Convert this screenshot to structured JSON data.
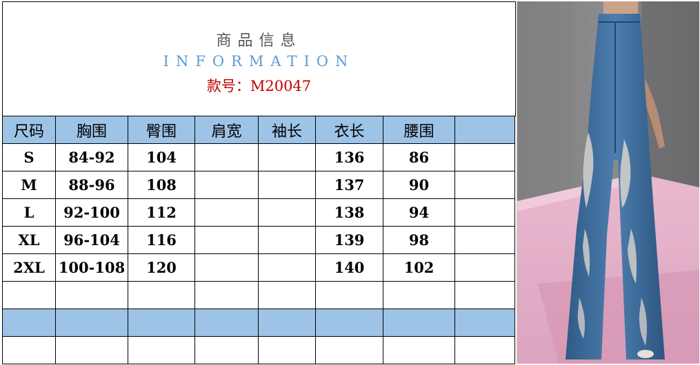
{
  "header": {
    "title_zh": "商品信息",
    "title_en": "INFORMATION",
    "model": "款号：M20047"
  },
  "table": {
    "columns": [
      "尺码",
      "胸围",
      "臀围",
      "肩宽",
      "袖长",
      "衣长",
      "腰围",
      ""
    ],
    "rows": [
      [
        "S",
        "84-92",
        "104",
        "",
        "",
        "136",
        "86",
        ""
      ],
      [
        "M",
        "88-96",
        "108",
        "",
        "",
        "137",
        "90",
        ""
      ],
      [
        "L",
        "92-100",
        "112",
        "",
        "",
        "138",
        "94",
        ""
      ],
      [
        "XL",
        "96-104",
        "116",
        "",
        "",
        "139",
        "98",
        ""
      ],
      [
        "2XL",
        "100-108",
        "120",
        "",
        "",
        "140",
        "102",
        ""
      ]
    ]
  },
  "colors": {
    "header_fill": "#9dc3e6",
    "title_en": "#5b9bd5",
    "model": "#c00000"
  },
  "photo": {
    "subject": "product-photo-jeans"
  }
}
